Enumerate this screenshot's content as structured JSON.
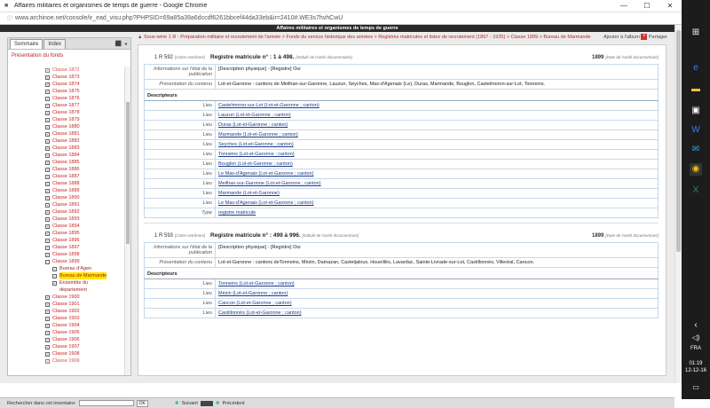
{
  "window": {
    "title": "Affaires militaires et organismes de temps de guerre - Google Chrome",
    "url": "www.archinoe.net/console/ir_ead_visu.php?PHPSID=69a85a39a6dccdf6261bbcef44da33eb&ir=2410#.WE3s7hvhCwU"
  },
  "site": {
    "banner": "Affaires militaires et organismes de temps de guerre",
    "breadcrumb": "Sous-série 1 R - Préparation militaire et recrutement de l'armée > Fonds du service historique des armées > Registres matricules et listes de recrutement (1867 - 1925) > Classe 1899 > Bureau de Marmande",
    "tool_add": "Ajouter à l'album",
    "tool_share": "Partager"
  },
  "sidebar": {
    "tab_summary": "Sommaire",
    "tab_index": "Index",
    "presentation": "Présentation du fonds",
    "items": [
      {
        "label": "Classe 1872",
        "kind": "cut"
      },
      {
        "label": "Classe 1873"
      },
      {
        "label": "Classe 1874"
      },
      {
        "label": "Classe 1875"
      },
      {
        "label": "Classe 1876"
      },
      {
        "label": "Classe 1877"
      },
      {
        "label": "Classe 1878"
      },
      {
        "label": "Classe 1879"
      },
      {
        "label": "Classe 1880"
      },
      {
        "label": "Classe 1881"
      },
      {
        "label": "Classe 1882"
      },
      {
        "label": "Classe 1883"
      },
      {
        "label": "Classe 1884"
      },
      {
        "label": "Classe 1885"
      },
      {
        "label": "Classe 1886"
      },
      {
        "label": "Classe 1887"
      },
      {
        "label": "Classe 1888"
      },
      {
        "label": "Classe 1889"
      },
      {
        "label": "Classe 1890"
      },
      {
        "label": "Classe 1891"
      },
      {
        "label": "Classe 1892"
      },
      {
        "label": "Classe 1893"
      },
      {
        "label": "Classe 1894"
      },
      {
        "label": "Classe 1895"
      },
      {
        "label": "Classe 1896"
      },
      {
        "label": "Classe 1897"
      },
      {
        "label": "Classe 1898"
      },
      {
        "label": "Classe 1899",
        "expanded": true
      },
      {
        "label": "Bureau d'Agen",
        "kind": "sub"
      },
      {
        "label": "Bureau de Marmande",
        "kind": "sub",
        "selected": true
      },
      {
        "label": "Ensemble du",
        "kind": "sub"
      },
      {
        "label": "département",
        "kind": "sub2"
      },
      {
        "label": "Classe 1900"
      },
      {
        "label": "Classe 1901"
      },
      {
        "label": "Classe 1902"
      },
      {
        "label": "Classe 1903"
      },
      {
        "label": "Classe 1904"
      },
      {
        "label": "Classe 1905"
      },
      {
        "label": "Classe 1906"
      },
      {
        "label": "Classe 1907"
      },
      {
        "label": "Classe 1908"
      },
      {
        "label": "Classe 1909",
        "kind": "cut"
      }
    ]
  },
  "records": [
    {
      "cote": "1 R 592",
      "cote_note": "[Cotes extrêmes]",
      "title": "Registre matricule n° : 1 à 498.",
      "title_note": "[Intitulé de l'unité documentaire]",
      "date": "1899",
      "date_note": "[Date de l'unité documentaire]",
      "physical_label": "Informations sur l'état de la publication",
      "physical_value": "[Description physique] - [Registre] Oui",
      "content_label": "Présentation du contenu",
      "content_value": "Lot-et-Garonne : cantons de Meilhan-sur-Garonne, Lauzun, Seyches, Mas-d'Agenais (Le), Duras, Marmande, Bouglon, Castelmoron-sur-Lot, Tonneins.",
      "descriptors_label": "Descripteurs",
      "descriptors": [
        {
          "type": "Lieu",
          "value": "Castelmoron-sur-Lot (Lot-et-Garonne ; canton)"
        },
        {
          "type": "Lieu",
          "value": "Lauzun (Lot-et-Garonne ; canton)"
        },
        {
          "type": "Lieu",
          "value": "Duras (Lot-et-Garonne ; canton)"
        },
        {
          "type": "Lieu",
          "value": "Marmande (Lot-et-Garonne ; canton)"
        },
        {
          "type": "Lieu",
          "value": "Seyches (Lot-et-Garonne ; canton)"
        },
        {
          "type": "Lieu",
          "value": "Tonneins (Lot-et-Garonne ; canton)"
        },
        {
          "type": "Lieu",
          "value": "Bouglon (Lot-et-Garonne ; canton)"
        },
        {
          "type": "Lieu",
          "value": "Le Mas-d'Agenais (Lot-et-Garonne ; canton)"
        },
        {
          "type": "Lieu",
          "value": "Meilhan-sur-Garonne (Lot-et-Garonne ; canton)"
        },
        {
          "type": "Lieu",
          "value": "Marmande (Lot-et-Garonne)"
        },
        {
          "type": "Lieu",
          "value": "Le Mas-d'Agenais (Lot-et-Garonne ; canton)"
        },
        {
          "type": "Type",
          "value": "registre matricule"
        }
      ]
    },
    {
      "cote": "1 R 593",
      "cote_note": "[Cotes extrêmes]",
      "title": "Registre matricule n° : 499 à 996.",
      "title_note": "[Intitulé de l'unité documentaire]",
      "date": "1899",
      "date_note": "[Date de l'unité documentaire]",
      "physical_label": "Informations sur l'état de la publication",
      "physical_value": "[Description physique] - [Registre] Oui",
      "content_label": "Présentation du contenu",
      "content_value": "Lot-et-Garonne : cantons deTonneins, Mézin, Damazan, Casteljaloux, Houeillès, Lavardac, Sainte-Livrade-sur-Lot, Castillonnès, Villeréal, Cancon.",
      "descriptors_label": "Descripteurs",
      "descriptors": [
        {
          "type": "Lieu",
          "value": "Tonneins (Lot-et-Garonne ; canton)"
        },
        {
          "type": "Lieu",
          "value": "Mézin (Lot-et-Garonne ; canton)"
        },
        {
          "type": "Lieu",
          "value": "Cancon (Lot-et-Garonne ; canton)"
        },
        {
          "type": "Lieu",
          "value": "Castillonnès (Lot-et-Garonne ; canton)"
        }
      ]
    }
  ],
  "bottom": {
    "search_label": "Rechercher dans cet inventaire:",
    "ok": "OK",
    "next": "Suivant",
    "prev": "Précédent"
  },
  "taskbar": {
    "lang": "FRA",
    "time": "01:19",
    "date": "12-12-16"
  }
}
